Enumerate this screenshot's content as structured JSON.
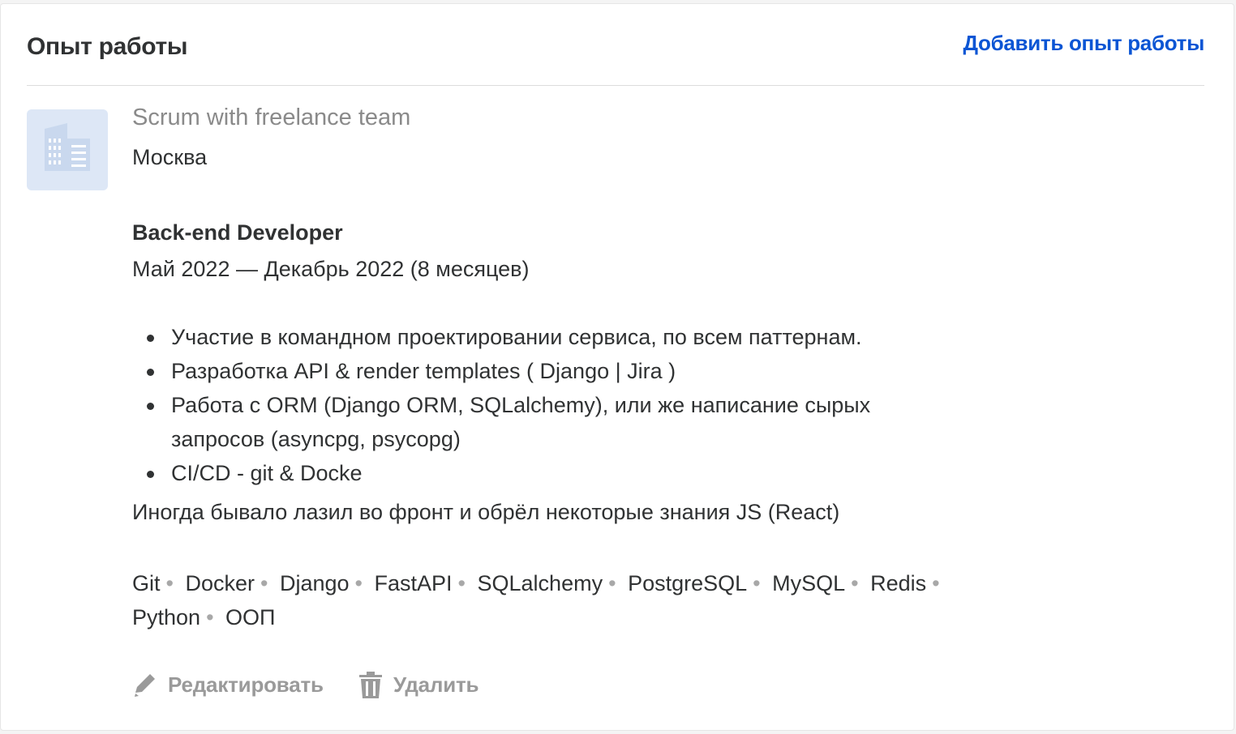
{
  "section": {
    "title": "Опыт работы",
    "add_link": "Добавить опыт работы"
  },
  "experience": {
    "company_logo_icon": "building-icon",
    "company": "Scrum with freelance team",
    "city": "Москва",
    "position": "Back-end Developer",
    "period": "Май 2022 — Декабрь 2022 (8 месяцев)",
    "duties": [
      "Участие в командном проектировании сервиса, по всем паттернам.",
      "Разработка API & render templates ( Django | Jira )",
      "Работа с ORM (Django ORM, SQLalchemy), или же написание сырых запросов (asyncpg, psycopg)",
      "CI/CD - git & Docke"
    ],
    "extra": "Иногда бывало лазил во фронт и обрёл некоторые знания JS (React)",
    "skills": [
      "Git",
      "Docker",
      "Django",
      "FastAPI",
      "SQLalchemy",
      "PostgreSQL",
      "MySQL",
      "Redis",
      "Python",
      "ООП"
    ],
    "skill_separator": "•"
  },
  "actions": {
    "edit_label": "Редактировать",
    "edit_icon": "pencil-icon",
    "delete_label": "Удалить",
    "delete_icon": "trash-icon"
  },
  "colors": {
    "link": "#0b55d4",
    "text": "#303233",
    "muted": "#8a8a8a",
    "logo_bg": "#dde7f6"
  }
}
